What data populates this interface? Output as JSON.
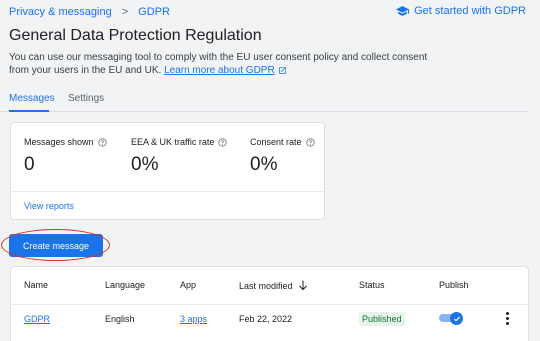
{
  "breadcrumb": {
    "parent": "Privacy & messaging",
    "separator": ">",
    "current": "GDPR"
  },
  "header": {
    "get_started_label": "Get started with GDPR",
    "get_started_icon": "school-icon"
  },
  "page": {
    "title": "General Data Protection Regulation",
    "description_line1": "You can use our messaging tool to comply with the EU user consent policy and collect consent",
    "description_line2": "from your users in the EU and UK.",
    "learn_more": "Learn more about GDPR"
  },
  "tabs": [
    {
      "label": "Messages",
      "active": true
    },
    {
      "label": "Settings",
      "active": false
    }
  ],
  "stats": {
    "metrics": [
      {
        "label": "Messages shown",
        "value": "0"
      },
      {
        "label": "EEA & UK traffic rate",
        "value": "0%"
      },
      {
        "label": "Consent rate",
        "value": "0%"
      }
    ],
    "view_reports": "View reports"
  },
  "actions": {
    "create_message": "Create message"
  },
  "table": {
    "columns": [
      "Name",
      "Language",
      "App",
      "Last modified",
      "Status",
      "Publish"
    ],
    "rows": [
      {
        "name": "GDPR",
        "language": "English",
        "app": "3 apps",
        "last_modified": "Feb 22, 2022",
        "status": "Published",
        "publish": true
      }
    ]
  },
  "colors": {
    "accent": "#1a73e8",
    "published_bg": "#e6f4ea",
    "published_text": "#137333",
    "highlight_ring": "#d93025"
  }
}
